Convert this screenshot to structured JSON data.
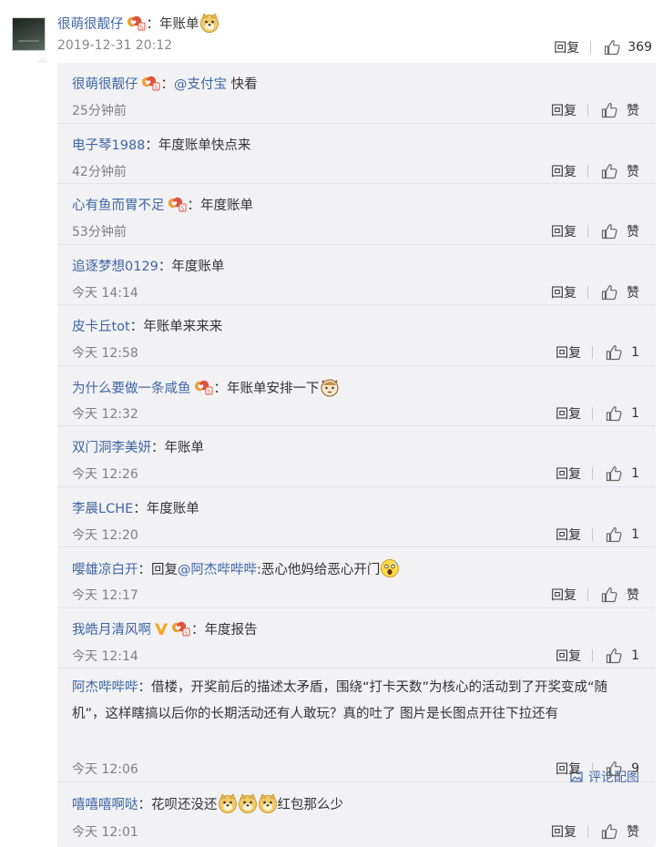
{
  "comment": {
    "username": "很萌很靓仔",
    "text": "年账单",
    "timestamp": "2019-12-31 20:12",
    "reply_label": "回复",
    "like_count": "369"
  },
  "replies": [
    {
      "username": "很萌很靓仔",
      "mention": "@支付宝",
      "text": "快看",
      "time": "25分钟前",
      "reply_label": "回复",
      "like_label": "赞"
    },
    {
      "username": "电子琴1988",
      "text": "年度账单快点来",
      "time": "42分钟前",
      "reply_label": "回复",
      "like_label": "赞"
    },
    {
      "username": "心有鱼而胃不足",
      "text": "年度账单",
      "time": "53分钟前",
      "reply_label": "回复",
      "like_label": "赞"
    },
    {
      "username": "追逐梦想0129",
      "text": "年度账单",
      "time": "今天 14:14",
      "reply_label": "回复",
      "like_label": "赞"
    },
    {
      "username": "皮卡丘tot",
      "text": "年账单来来来",
      "time": "今天 12:58",
      "reply_label": "回复",
      "like_label": "1"
    },
    {
      "username": "为什么要做一条咸鱼",
      "text": "年账单安排一下",
      "time": "今天 12:32",
      "reply_label": "回复",
      "like_label": "1"
    },
    {
      "username": "双门洞李美妍",
      "text": "年账单",
      "time": "今天 12:26",
      "reply_label": "回复",
      "like_label": "1"
    },
    {
      "username": "李晨LCHE",
      "text": "年度账单",
      "time": "今天 12:20",
      "reply_label": "回复",
      "like_label": "1"
    },
    {
      "username": "嘤雄凉白开",
      "reply_prefix": "回复",
      "mention": "@阿杰哔哔哔",
      "text": ":恶心他妈给恶心开门",
      "time": "今天 12:17",
      "reply_label": "回复",
      "like_label": "赞"
    },
    {
      "username": "我皓月清风啊",
      "text": "年度报告",
      "time": "今天 12:14",
      "reply_label": "回复",
      "like_label": "1"
    },
    {
      "username": "阿杰哔哔哔",
      "text": "借楼，开奖前后的描述太矛盾，围绕“打卡天数”为核心的活动到了开奖变成“随机”，这样瞎搞以后你的长期活动还有人敢玩？真的吐了  图片是长图点开往下拉还有",
      "pic_label": "评论配图",
      "time": "今天 12:06",
      "reply_label": "回复",
      "like_label": "9"
    },
    {
      "username": "嘻嘻嘻啊哒",
      "text_before": "花呗还没还",
      "text_after": "红包那么少",
      "time": "今天 12:01",
      "reply_label": "回复",
      "like_label": "赞"
    }
  ],
  "colors": {
    "username": "#3f66a4",
    "text": "#333333",
    "meta": "#808080",
    "panel": "#f2f2f5",
    "separator": "#e3e3e8"
  }
}
